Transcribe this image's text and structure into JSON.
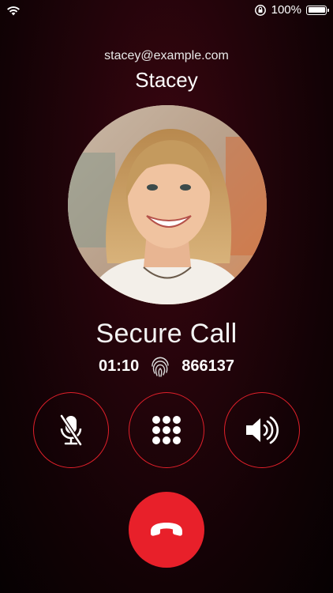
{
  "status_bar": {
    "battery_text": "100%",
    "battery_level": 1.0
  },
  "contact": {
    "email": "stacey@example.com",
    "name": "Stacey"
  },
  "call": {
    "title": "Secure Call",
    "duration": "01:10",
    "code": "866137"
  },
  "controls": {
    "mute_icon": "microphone-off-icon",
    "keypad_icon": "keypad-icon",
    "speaker_icon": "speaker-icon",
    "end_icon": "phone-hangup-icon"
  },
  "colors": {
    "accent": "#e8202a",
    "background": "#22040a"
  }
}
